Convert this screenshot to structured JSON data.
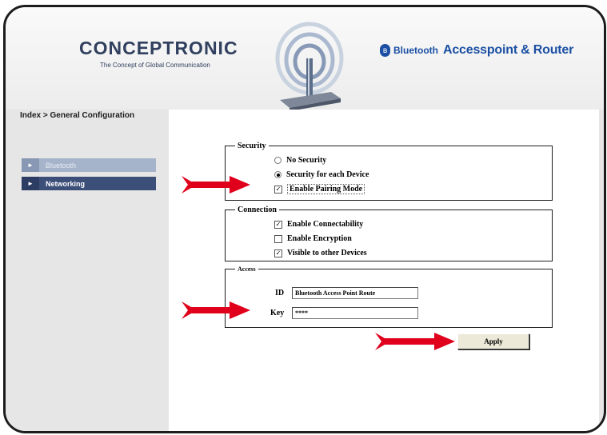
{
  "header": {
    "brand": "CONCEPTRONIC",
    "tagline": "The Concept of Global Communication",
    "bt_badge": "ʙ",
    "bt_word": "Bluetooth",
    "product_name": "Accesspoint & Router",
    "graphic_icon": "wireless-router-icon"
  },
  "breadcrumb": "Index > General Configuration",
  "sidebar": {
    "items": [
      {
        "label": "Bluetooth",
        "bullet": "►"
      },
      {
        "label": "Networking",
        "bullet": "►"
      }
    ]
  },
  "security": {
    "legend": "Security",
    "options": [
      {
        "label": "No Security",
        "selected": false
      },
      {
        "label": "Security for each Device",
        "selected": true
      }
    ],
    "pairing": {
      "label": "Enable Pairing Mode",
      "checked": true
    }
  },
  "connection": {
    "legend": "Connection",
    "options": [
      {
        "label": "Enable Connectability",
        "checked": true
      },
      {
        "label": "Enable Encryption",
        "checked": false
      },
      {
        "label": "Visible to other Devices",
        "checked": true
      }
    ]
  },
  "access": {
    "legend": "Access",
    "id_label": "ID",
    "id_value": "Bluetooth Access Point Route",
    "key_label": "Key",
    "key_value": "****"
  },
  "apply_label": "Apply",
  "check_glyph": "✓",
  "colors": {
    "accent_blue": "#1a4fa3",
    "brand_navy": "#30405e",
    "sidebar_active": "#3c4f79",
    "sidebar_inactive": "#a6b4cb",
    "arrow_red": "#e0001b"
  }
}
